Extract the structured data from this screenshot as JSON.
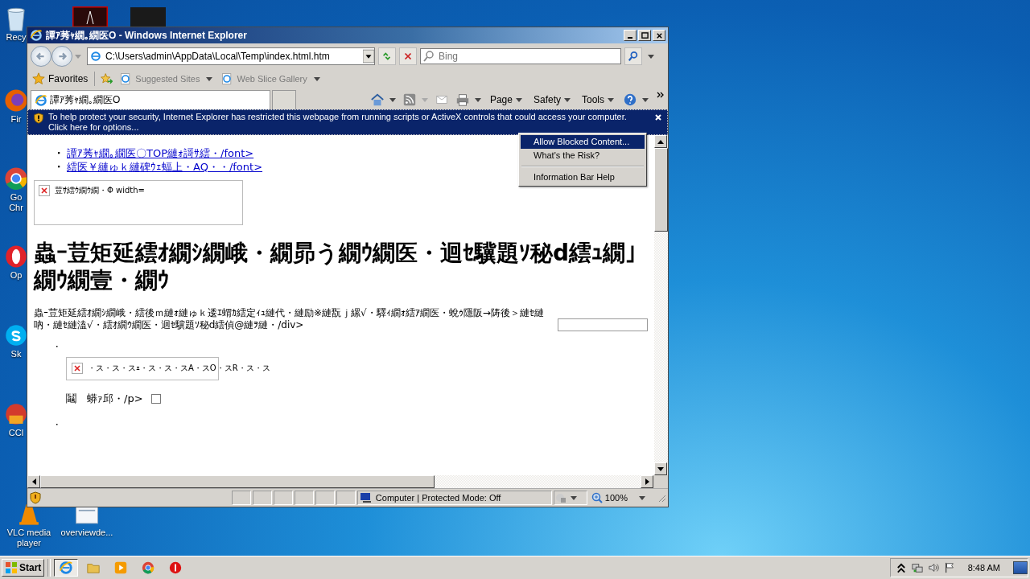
{
  "desktop": {
    "icons": [
      {
        "kind": "recycle",
        "label": "Recy"
      },
      {
        "kind": "firefox",
        "label": "Fir"
      },
      {
        "kind": "chrome",
        "label": "Go Chr"
      },
      {
        "kind": "opera",
        "label": "Op"
      },
      {
        "kind": "skype",
        "label": "Sk"
      },
      {
        "kind": "ccleaner",
        "label": "CCl"
      }
    ],
    "bottom_icons": [
      {
        "kind": "vlc",
        "label": "VLC media player"
      },
      {
        "kind": "document",
        "label": "overviewde..."
      }
    ]
  },
  "window": {
    "title": "譚ｱ莠ｬ繝｡繝医O - Windows Internet Explorer",
    "address": "C:\\Users\\admin\\AppData\\Local\\Temp\\index.html.htm",
    "search": {
      "placeholder": "Bing"
    },
    "favorites": {
      "label": "Favorites",
      "items": [
        "Suggested Sites",
        "Web Slice Gallery"
      ]
    },
    "tab": {
      "label": "譚ｱ莠ｬ繝｡繝医O",
      "selected": true
    },
    "commands": [
      "Page",
      "Safety",
      "Tools"
    ],
    "info_bar": "To help protect your security, Internet Explorer has restricted this webpage from running scripts or ActiveX controls that could access your computer. Click here for options...",
    "menu": [
      {
        "kind": "item",
        "label": "Allow Blocked Content...",
        "selected": true
      },
      {
        "kind": "item",
        "label": "What's the Risk?",
        "selected": false
      },
      {
        "kind": "separator"
      },
      {
        "kind": "item",
        "label": "Information Bar Help",
        "selected": false
      }
    ],
    "page": {
      "links": [
        "譚ｱ莠ｬ繝｡繝医〇TOP縺ｫ謌ｻ繧・/font>",
        "繧医￥縺ゅｋ縺碑ｳｪ蝠上・AQ・・/font>"
      ],
      "image_alt": "荳ｻ繧ｳ繝ｳ繝・Φ width=",
      "heading": "蟲ｰ荳矩延繧ｵ繝ｼ繝峨・繝昴う繝ｳ繝医・迴ｾ驥題ｿ秘d繧ｭ繝｣繝ｳ繝壹・繝ｳ",
      "paragraph": "蟲ｰ荳矩延繧ｵ繝ｼ繝峨・繧後ｍ縺ｫ縺ゅｋ逶ｴ蝟ｶ繧定ｨｭ縺代・縺励※縺翫ｊ縲√・驛ｨ繝ｫ繧ｱ繝医・蛻ｩ隱阪→陦後＞縺ｾ縺吶・縺ｾ縺溘√・繧ｵ繝ｳ繝医・迴ｾ驥題ｿ秘d繧偵@縺ｦ縺・/div>",
      "list_image_alt": "・ス・ス・スｪ・ス・ス・スA・スO・スR・ス・ス",
      "list_text": "鬮　蟒ｧ邱・/p>",
      "checkbox": {
        "checked": false
      }
    },
    "status": {
      "zone": "Computer | Protected Mode: Off",
      "zoom": "100%"
    }
  },
  "taskbar": {
    "start": "Start",
    "apps": [
      {
        "kind": "ie",
        "selected": true
      },
      {
        "kind": "folder",
        "selected": false
      },
      {
        "kind": "media",
        "selected": false
      },
      {
        "kind": "chrome",
        "selected": false
      },
      {
        "kind": "stop",
        "selected": false
      }
    ],
    "clock": "8:48 AM"
  }
}
